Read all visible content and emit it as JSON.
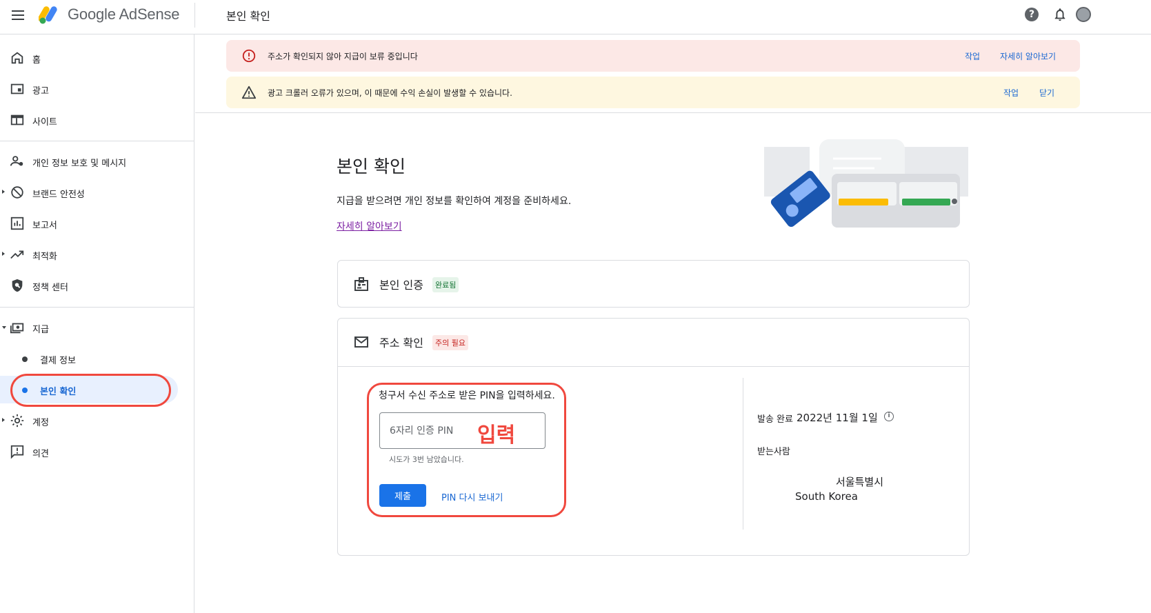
{
  "app": {
    "product": "Google AdSense",
    "page_title": "본인 확인"
  },
  "sidebar": {
    "items": [
      {
        "label": "홈",
        "icon": "home-icon"
      },
      {
        "label": "광고",
        "icon": "ads-icon"
      },
      {
        "label": "사이트",
        "icon": "sites-icon"
      },
      {
        "label": "개인 정보 보호 및 메시지",
        "icon": "privacy-icon"
      },
      {
        "label": "브랜드 안전성",
        "icon": "block-icon"
      },
      {
        "label": "보고서",
        "icon": "reports-icon"
      },
      {
        "label": "최적화",
        "icon": "trending-icon"
      },
      {
        "label": "정책 센터",
        "icon": "policy-shield-icon"
      },
      {
        "label": "지급",
        "icon": "payments-icon"
      },
      {
        "label": "결제 정보"
      },
      {
        "label": "본인 확인"
      },
      {
        "label": "계정",
        "icon": "gear-icon"
      },
      {
        "label": "의견",
        "icon": "feedback-icon"
      }
    ]
  },
  "banners": {
    "error": {
      "text": "주소가 확인되지 않아 지급이 보류 중입니다",
      "action": "작업",
      "learn": "자세히 알아보기"
    },
    "warn": {
      "text": "광고 크롤러 오류가 있으며, 이 때문에 수익 손실이 발생할 수 있습니다.",
      "action": "작업",
      "close": "닫기"
    }
  },
  "main": {
    "title": "본인 확인",
    "description": "지급을 받으려면 개인 정보를 확인하여 계정을 준비하세요.",
    "learn_more": "자세히 알아보기"
  },
  "identity_card": {
    "title": "본인 인증",
    "status": "완료됨"
  },
  "address_card": {
    "title": "주소 확인",
    "status": "주의 필요",
    "pin_prompt": "청구서 수신 주소로 받은 PIN을 입력하세요.",
    "pin_placeholder": "6자리 인증 PIN",
    "pin_overlay": "입력",
    "pin_helper": "시도가 3번 남았습니다.",
    "submit": "제출",
    "resend": "PIN 다시 보내기",
    "sent_label": "발송 완료",
    "sent_date": "2022년 11월 1일",
    "recipient_label": "받는사람",
    "address_city": "서울특별시",
    "address_country": "South Korea"
  },
  "colors": {
    "accent": "#1a73e8",
    "annotation": "#f0483e",
    "error_bg": "#fce8e6",
    "warn_bg": "#fef7e0"
  }
}
